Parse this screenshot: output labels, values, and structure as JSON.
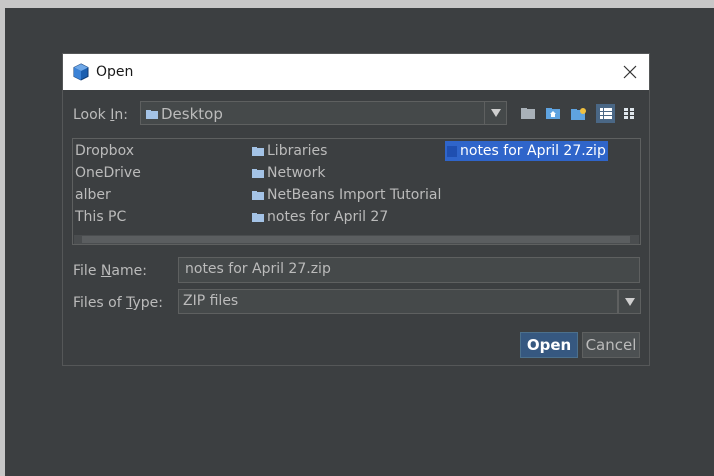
{
  "dialog": {
    "title": "Open",
    "close_symbol": "✕"
  },
  "look_in": {
    "label_pre": "Look ",
    "label_mnemonic": "I",
    "label_post": "n:",
    "value": "Desktop"
  },
  "toolbar": {
    "buttons": [
      "up-folder-icon",
      "home-icon",
      "new-folder-icon",
      "list-view-icon",
      "details-view-icon"
    ]
  },
  "files": {
    "col1": [
      "Dropbox",
      "OneDrive",
      "alber",
      "This PC"
    ],
    "col2": [
      "Libraries",
      "Network",
      "NetBeans Import Tutorial",
      "notes for April 27"
    ],
    "col3": [
      "notes for April 27.zip"
    ]
  },
  "file_name": {
    "label_pre": "File ",
    "label_mnemonic": "N",
    "label_post": "ame:",
    "value": "notes for April 27.zip"
  },
  "file_type": {
    "label_pre": "Files of ",
    "label_mnemonic": "T",
    "label_post": "ype:",
    "value": "ZIP files"
  },
  "buttons": {
    "open": "Open",
    "cancel": "Cancel"
  },
  "colors": {
    "selection": "#2f65ca",
    "folder": "#a4c3e6",
    "primary_button": "#365880"
  }
}
